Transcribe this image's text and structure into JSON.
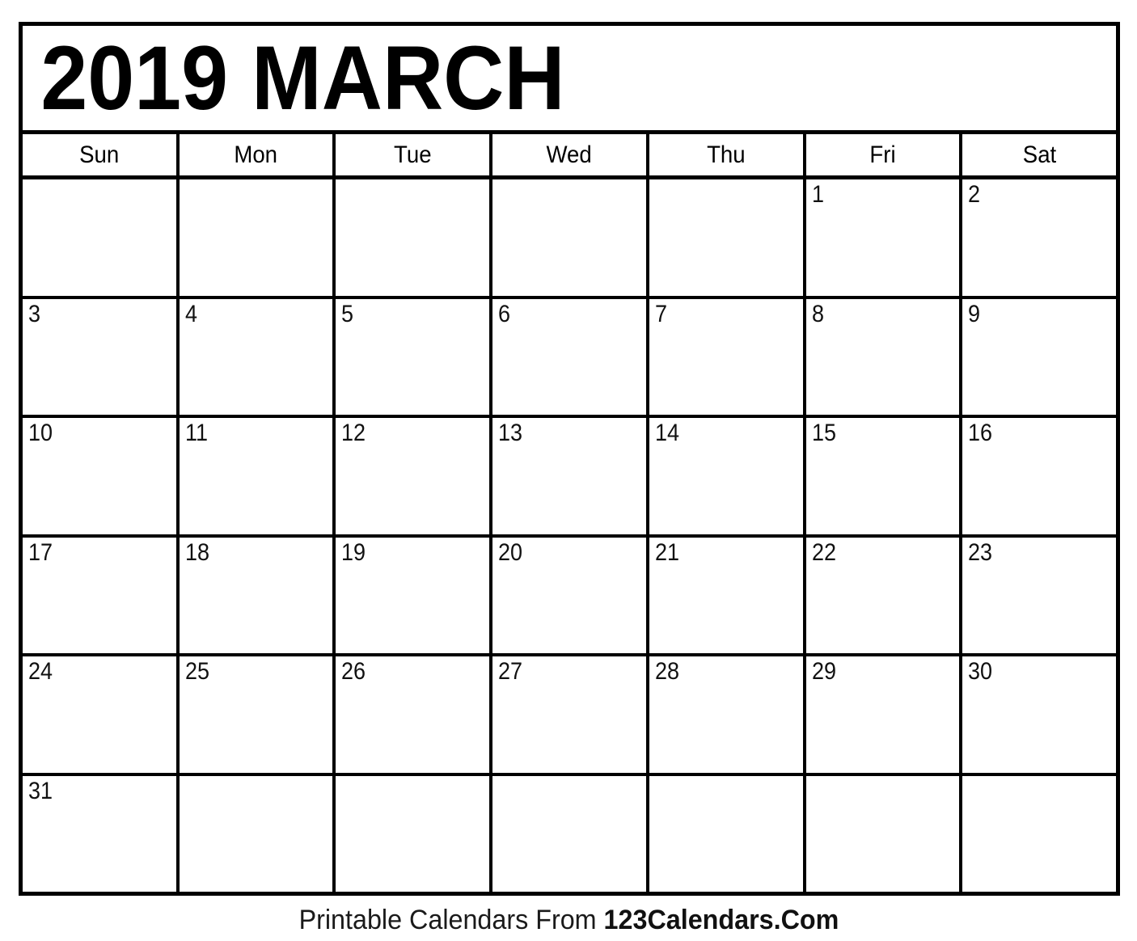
{
  "calendar": {
    "title": "2019 MARCH",
    "year": "2019",
    "month": "MARCH",
    "weekday_headers": [
      {
        "label": "Sun"
      },
      {
        "label": "Mon"
      },
      {
        "label": "Tue"
      },
      {
        "label": "Wed"
      },
      {
        "label": "Thu"
      },
      {
        "label": "Fri"
      },
      {
        "label": "Sat"
      }
    ],
    "weeks": [
      {
        "days": [
          {
            "label": "",
            "empty": true
          },
          {
            "label": "",
            "empty": true
          },
          {
            "label": "",
            "empty": true
          },
          {
            "label": "",
            "empty": true
          },
          {
            "label": "",
            "empty": true
          },
          {
            "label": "1",
            "empty": false
          },
          {
            "label": "2",
            "empty": false
          }
        ]
      },
      {
        "days": [
          {
            "label": "3",
            "empty": false
          },
          {
            "label": "4",
            "empty": false
          },
          {
            "label": "5",
            "empty": false
          },
          {
            "label": "6",
            "empty": false
          },
          {
            "label": "7",
            "empty": false
          },
          {
            "label": "8",
            "empty": false
          },
          {
            "label": "9",
            "empty": false
          }
        ]
      },
      {
        "days": [
          {
            "label": "10",
            "empty": false
          },
          {
            "label": "11",
            "empty": false
          },
          {
            "label": "12",
            "empty": false
          },
          {
            "label": "13",
            "empty": false
          },
          {
            "label": "14",
            "empty": false
          },
          {
            "label": "15",
            "empty": false
          },
          {
            "label": "16",
            "empty": false
          }
        ]
      },
      {
        "days": [
          {
            "label": "17",
            "empty": false
          },
          {
            "label": "18",
            "empty": false
          },
          {
            "label": "19",
            "empty": false
          },
          {
            "label": "20",
            "empty": false
          },
          {
            "label": "21",
            "empty": false
          },
          {
            "label": "22",
            "empty": false
          },
          {
            "label": "23",
            "empty": false
          }
        ]
      },
      {
        "days": [
          {
            "label": "24",
            "empty": false
          },
          {
            "label": "25",
            "empty": false
          },
          {
            "label": "26",
            "empty": false
          },
          {
            "label": "27",
            "empty": false
          },
          {
            "label": "28",
            "empty": false
          },
          {
            "label": "29",
            "empty": false
          },
          {
            "label": "30",
            "empty": false
          }
        ]
      },
      {
        "days": [
          {
            "label": "31",
            "empty": false
          },
          {
            "label": "",
            "empty": true
          },
          {
            "label": "",
            "empty": true
          },
          {
            "label": "",
            "empty": true
          },
          {
            "label": "",
            "empty": true
          },
          {
            "label": "",
            "empty": true
          },
          {
            "label": "",
            "empty": true
          }
        ]
      }
    ]
  },
  "footer": {
    "prefix": "Printable Calendars From ",
    "brand": "123Calendars.Com"
  },
  "colors": {
    "border": "#000000",
    "background": "#ffffff",
    "title_text": "#000000",
    "day_number_text": "#111111",
    "footer_text": "#1a1a1a"
  }
}
